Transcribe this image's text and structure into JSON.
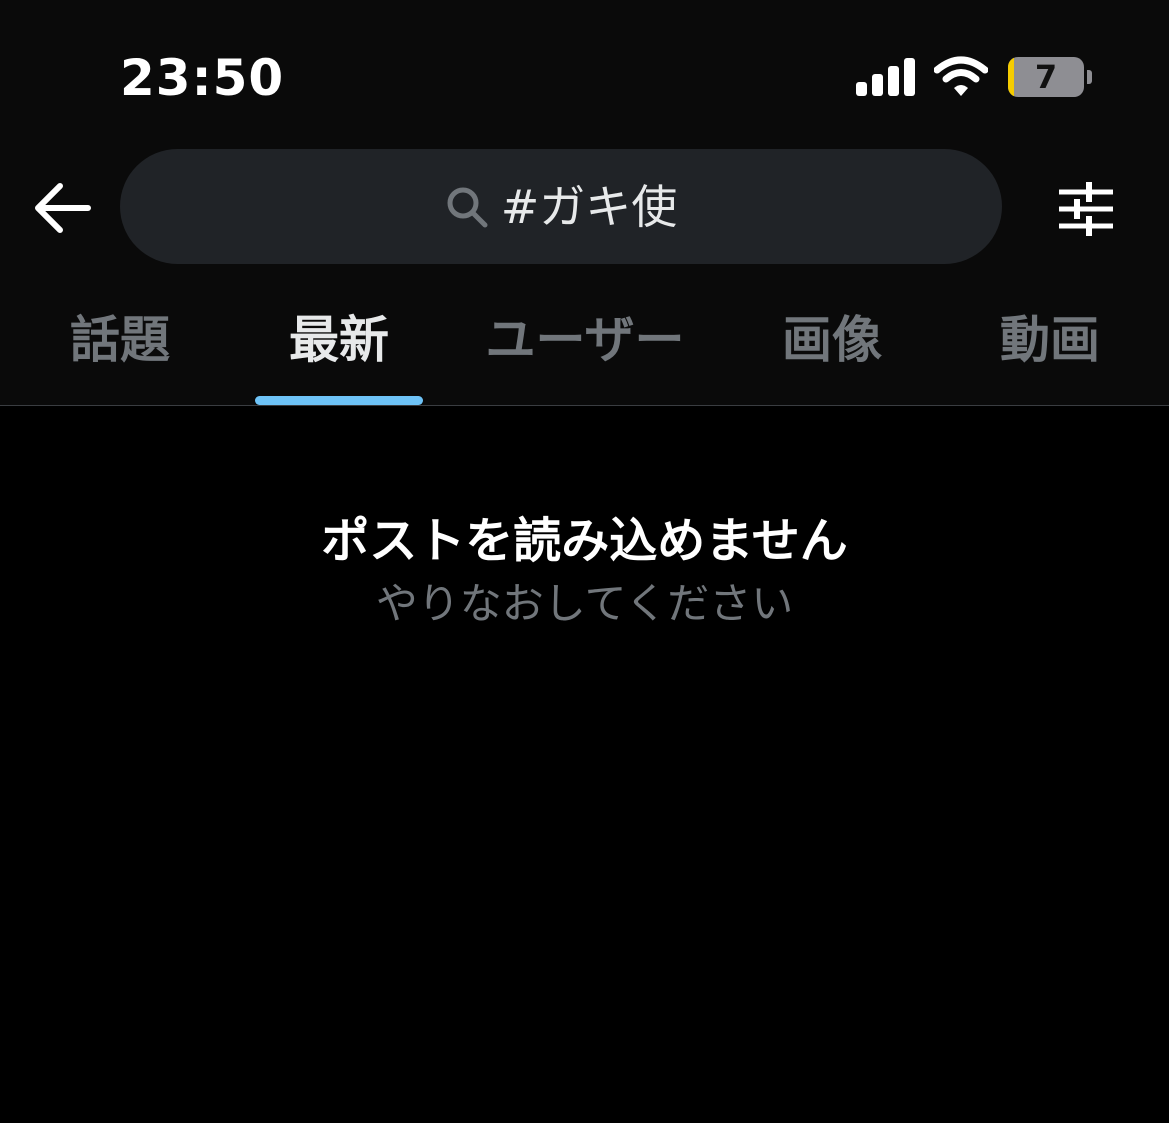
{
  "status_bar": {
    "time": "23:50",
    "signal_icon": "cellular-signal-icon",
    "wifi_icon": "wifi-icon",
    "battery_level_percent": 7,
    "battery_label": "7",
    "battery_fill_color": "#f5cc00"
  },
  "header": {
    "back_icon": "arrow-left-icon",
    "filter_icon": "sliders-icon"
  },
  "search": {
    "icon": "search-icon",
    "query": "#ガキ使"
  },
  "tabs": [
    {
      "label": "話題",
      "active": false
    },
    {
      "label": "最新",
      "active": true
    },
    {
      "label": "ユーザー",
      "active": false
    },
    {
      "label": "画像",
      "active": false
    },
    {
      "label": "動画",
      "active": false
    }
  ],
  "colors": {
    "accent": "#6ec3f7",
    "background": "#000000",
    "muted_text": "#71767b"
  },
  "error": {
    "title": "ポストを読み込めません",
    "subtitle": "やりなおしてください"
  }
}
